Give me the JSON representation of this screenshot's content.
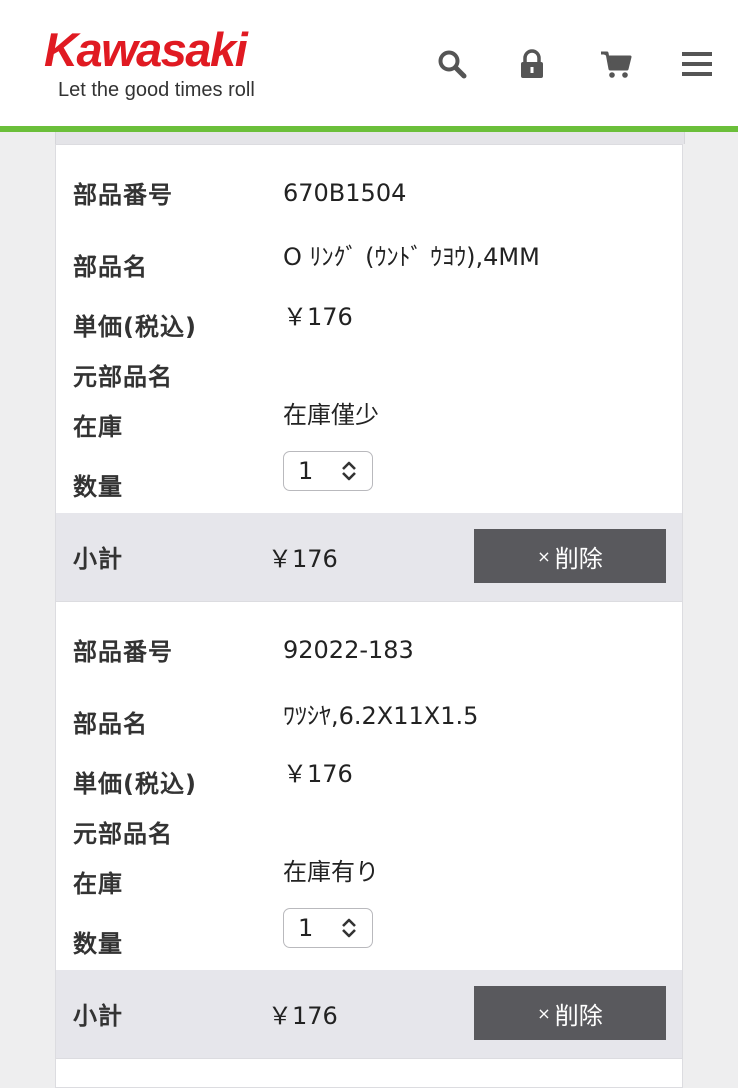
{
  "header": {
    "brand": "Kawasaki",
    "tagline": "Let the good times roll",
    "brand_color": "#e01a22",
    "accent_color": "#6bbf3a",
    "icons": [
      "search-icon",
      "lock-icon",
      "cart-icon",
      "menu-icon"
    ]
  },
  "labels": {
    "part_number": "部品番号",
    "part_name": "部品名",
    "unit_price": "単価(税込)",
    "original_part_name": "元部品名",
    "stock": "在庫",
    "quantity": "数量",
    "subtotal": "小計",
    "delete": "削除",
    "delete_x": "×"
  },
  "items": [
    {
      "part_number": "670B1504",
      "part_name": "O ﾘﾝｸﾞ (ｳﾝﾄﾞ ｳﾖｳ),4MM",
      "unit_price": "￥176",
      "original_part_name": "",
      "stock": "在庫僅少",
      "quantity": "1",
      "subtotal": "￥176"
    },
    {
      "part_number": "92022-183",
      "part_name": "ﾜﾂｼﾔ,6.2X11X1.5",
      "unit_price": "￥176",
      "original_part_name": "",
      "stock": "在庫有り",
      "quantity": "1",
      "subtotal": "￥176"
    }
  ]
}
